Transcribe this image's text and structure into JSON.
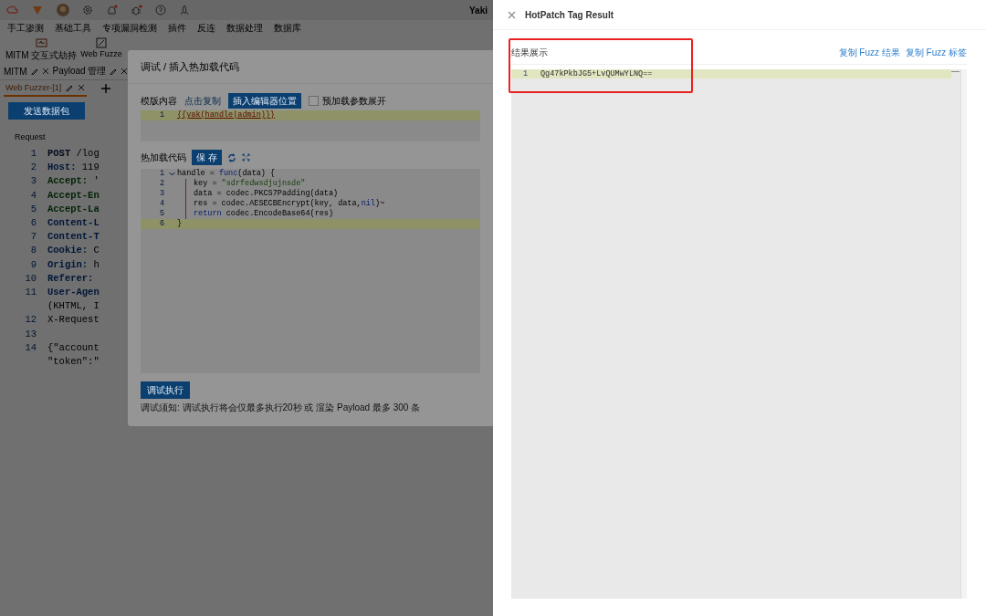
{
  "app": {
    "title": "Yaki",
    "menu": [
      "手工渗测",
      "基础工具",
      "专项漏洞检测",
      "插件",
      "反连",
      "数据处理",
      "数据库"
    ],
    "tools": [
      "MITM 交互式劫持",
      "Web Fuzze"
    ],
    "tabs": [
      "MITM",
      "Payload 管理"
    ],
    "subtabs": [
      {
        "label": "Web Fuzzer-[1]",
        "selected": true
      }
    ],
    "send_button": "发送数据包",
    "request_label": "Request",
    "request_lines": [
      {
        "num": "1",
        "key": "POST",
        "rest": " /log",
        "kind": "method"
      },
      {
        "num": "2",
        "key": "Host:",
        "rest": " 119",
        "kind": "header"
      },
      {
        "num": "3",
        "key": "Accept:",
        "rest": " '",
        "kind": "accept"
      },
      {
        "num": "4",
        "key": "Accept-En",
        "kind": "accept"
      },
      {
        "num": "5",
        "key": "Accept-La",
        "kind": "accept"
      },
      {
        "num": "6",
        "key": "Content-L",
        "kind": "header"
      },
      {
        "num": "7",
        "key": "Content-T",
        "kind": "header"
      },
      {
        "num": "8",
        "key": "Cookie:",
        "rest": " C",
        "kind": "header"
      },
      {
        "num": "9",
        "key": "Origin:",
        "rest": " h",
        "kind": "header"
      },
      {
        "num": "10",
        "key": "Referer:",
        "kind": "header"
      },
      {
        "num": "11",
        "key": "User-Agen",
        "kind": "header"
      },
      {
        "rest": "(KHTML, I",
        "kind": "plain"
      },
      {
        "num": "12",
        "rest": "X-Request",
        "kind": "plain"
      },
      {
        "num": "13"
      },
      {
        "num": "14",
        "rest": "{\"account",
        "kind": "json"
      },
      {
        "rest": "\"token\":\"",
        "kind": "json"
      }
    ]
  },
  "modal": {
    "title": "调试 / 插入热加载代码",
    "template_label": "模版内容",
    "copy_link": "点击复制",
    "insert_button": "插入编辑器位置",
    "preload": {
      "label": "预加载参数展开",
      "checked": false
    },
    "template_lines": [
      {
        "num": "1",
        "text": "{{yak(handle|admin)}}"
      }
    ],
    "code_label": "热加载代码",
    "save_button": "保 存",
    "code_lines": [
      {
        "num": "1",
        "fold": true,
        "indented": false,
        "current": false,
        "tokens": [
          {
            "text": "handle = ",
            "kind": "plain"
          },
          {
            "text": "func",
            "kind": "keyword"
          },
          {
            "text": "(data) {",
            "kind": "plain"
          }
        ]
      },
      {
        "num": "2",
        "fold": false,
        "indented": true,
        "current": false,
        "tokens": [
          {
            "text": "key = ",
            "kind": "plain"
          },
          {
            "text": "\"sdrfedwsdjujnsde\"",
            "kind": "string"
          }
        ]
      },
      {
        "num": "3",
        "fold": false,
        "indented": true,
        "current": false,
        "tokens": [
          {
            "text": "data = codec.PKCS7Padding(data)",
            "kind": "plain"
          }
        ]
      },
      {
        "num": "4",
        "fold": false,
        "indented": true,
        "current": false,
        "tokens": [
          {
            "text": "res = codec.AESECBEncrypt(key, data,",
            "kind": "plain"
          },
          {
            "text": "nil",
            "kind": "keyword"
          },
          {
            "text": ")~",
            "kind": "plain"
          }
        ]
      },
      {
        "num": "5",
        "fold": false,
        "indented": true,
        "current": false,
        "tokens": [
          {
            "text": "return",
            "kind": "keyword"
          },
          {
            "text": " codec.EncodeBase64(res)",
            "kind": "plain"
          }
        ]
      },
      {
        "num": "6",
        "fold": false,
        "indented": false,
        "current": true,
        "tokens": [
          {
            "text": "}",
            "kind": "plain"
          }
        ]
      }
    ],
    "run_button": "调试执行",
    "note": "调试须知: 调试执行将会仅最多执行20秒 或 渲染 Payload 最多 300 条"
  },
  "drawer": {
    "title": "HotPatch Tag Result",
    "section": "结果展示",
    "links": [
      "复制 Fuzz 结果",
      "复制 Fuzz 标签"
    ],
    "result_lines": [
      {
        "num": "1",
        "text": "Qg47kPkbJG5+LvQUMwYLNQ=="
      }
    ]
  }
}
